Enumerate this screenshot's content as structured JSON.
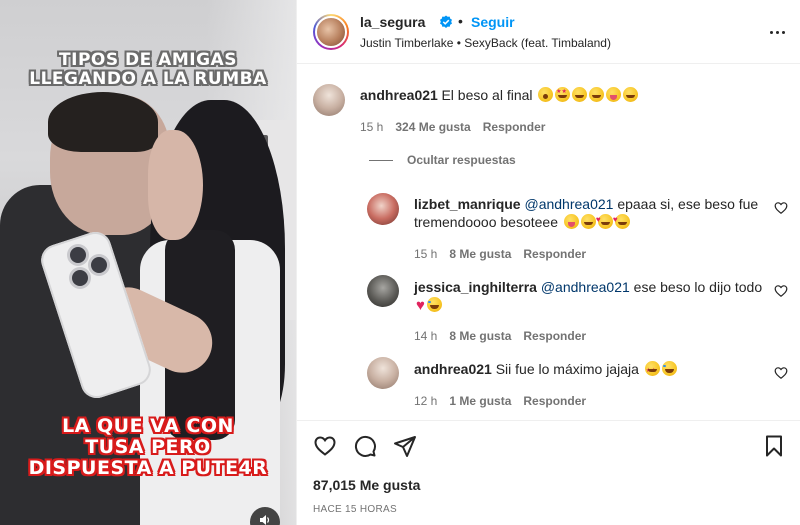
{
  "media": {
    "caption_top_line1": "TIPOS DE AMIGAS",
    "caption_top_line2": "LLEGANDO A LA RUMBA",
    "caption_bottom_line1": "LA QUE VA CON",
    "caption_bottom_line2": "TUSA PERO",
    "caption_bottom_line3": "DISPUESTA A PUTE4R",
    "mute_icon": "speaker-icon"
  },
  "header": {
    "username": "la_segura",
    "separator": "•",
    "follow_label": "Seguir",
    "song": "Justin Timberlake • SexyBack (feat. Timbaland)",
    "verified_icon": "verified-badge-icon",
    "more_icon": "more-options-icon"
  },
  "comments": [
    {
      "username": "andhrea021",
      "text": "El beso al final",
      "time": "15 h",
      "likes": "324 Me gusta",
      "reply_label": "Responder"
    }
  ],
  "hide_replies_label": "Ocultar respuestas",
  "replies": [
    {
      "username": "lizbet_manrique",
      "mention": "@andhrea021",
      "text_line1": " epaaa si, ese beso fue",
      "text_line2": "tremendoooo besoteee",
      "time": "15 h",
      "likes": "8 Me gusta",
      "reply_label": "Responder"
    },
    {
      "username": "jessica_inghilterra",
      "mention": "@andhrea021",
      "text_line1": " ese beso lo dijo todo",
      "time": "14 h",
      "likes": "8 Me gusta",
      "reply_label": "Responder"
    },
    {
      "username": "andhrea021",
      "text_line1": "Sii fue lo máximo jajaja",
      "time": "12 h",
      "likes": "1 Me gusta",
      "reply_label": "Responder"
    }
  ],
  "footer": {
    "likes": "87,015 Me gusta",
    "time_ago": "HACE 15 HORAS"
  },
  "colors": {
    "accent": "#0095f6",
    "text": "#262626",
    "secondary": "#737373",
    "border": "#efefef",
    "caption_bottom_outline": "#d81b1b"
  }
}
